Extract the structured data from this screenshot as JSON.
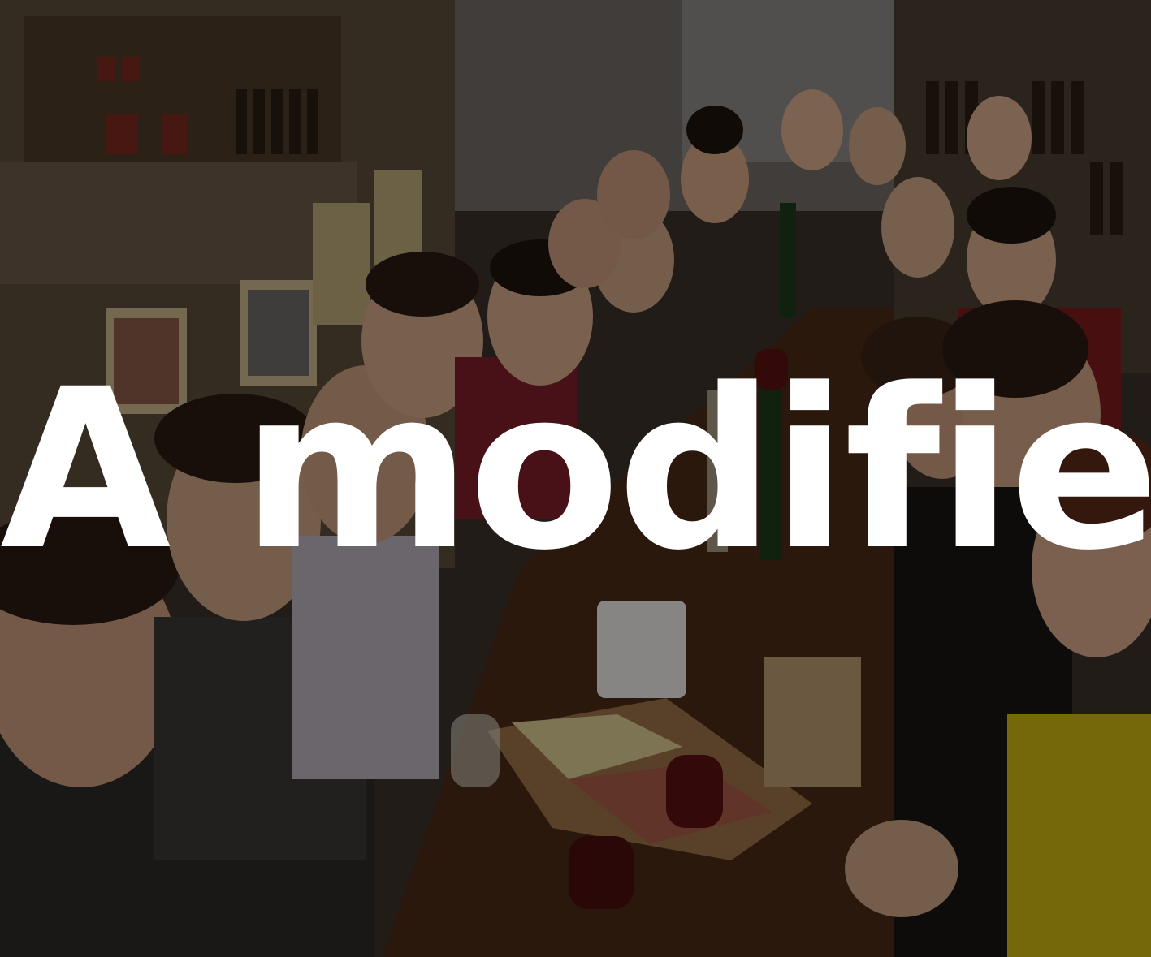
{
  "overlay": {
    "caption": "A modifier",
    "caption_color": "#ffffff",
    "dim_color": "#000000"
  },
  "photo": {
    "subject": "group-dinner-photo"
  }
}
